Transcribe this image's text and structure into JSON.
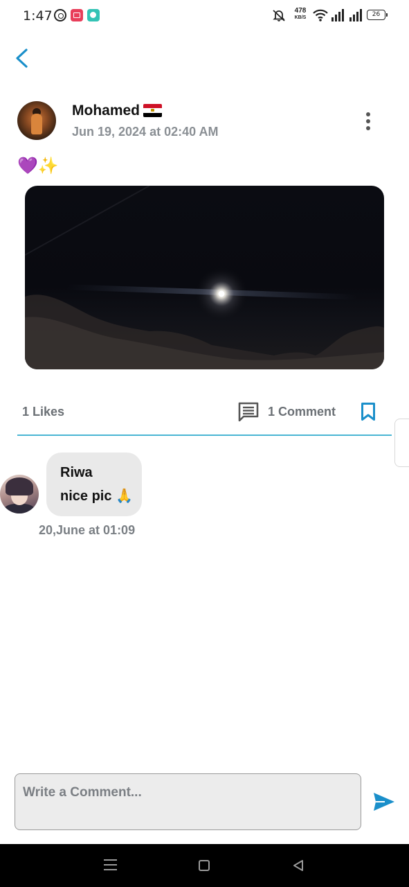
{
  "status_bar": {
    "time": "1:47",
    "net_speed": "478",
    "net_speed_unit": "KB/S",
    "battery": "26",
    "icons": [
      "whatsapp-icon",
      "screen-recorder-icon",
      "chat-app-icon",
      "mute-icon",
      "wifi-icon",
      "signal-icon",
      "signal-icon",
      "battery-icon"
    ]
  },
  "header": {
    "back_icon": "chevron-left-icon"
  },
  "post": {
    "author": "Mohamed",
    "author_flag": "egypt-flag-icon",
    "date": "Jun 19, 2024 at 02:40 AM",
    "caption": "💜✨",
    "image": "night-sky-moon-photo",
    "menu_icon": "more-vertical-icon"
  },
  "actions": {
    "likes": "1 Likes",
    "comments": "1 Comment",
    "comment_icon": "comment-icon",
    "bookmark_icon": "bookmark-icon"
  },
  "comments": [
    {
      "author": "Riwa",
      "text": "nice pic 🙏",
      "time": "20,June at 01:09"
    }
  ],
  "composer": {
    "placeholder": "Write a Comment...",
    "send_icon": "send-icon"
  },
  "colors": {
    "accent": "#1a8fca",
    "divider": "#49b5d3",
    "bubble": "#e9e9e9",
    "muted_text": "#7a7f84"
  }
}
